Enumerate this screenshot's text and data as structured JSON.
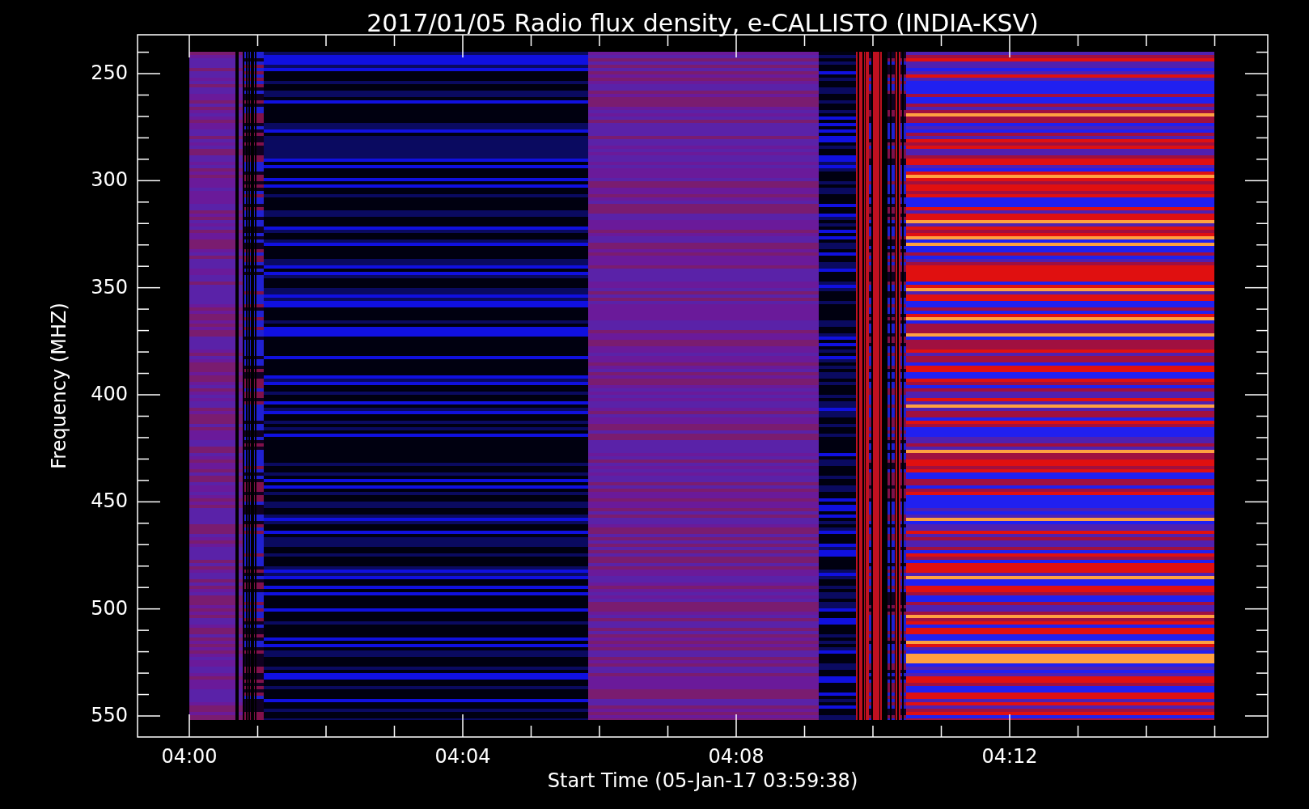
{
  "title": "2017/01/05  Radio flux density, e-CALLISTO (INDIA-KSV)",
  "y_axis": {
    "label": "Frequency (MHZ)",
    "ticks": [
      "250",
      "300",
      "350",
      "400",
      "450",
      "500",
      "550"
    ]
  },
  "x_axis": {
    "label": "Start Time (05-Jan-17 03:59:38)",
    "ticks": [
      "04:00",
      "04:04",
      "04:08",
      "04:12"
    ]
  }
}
